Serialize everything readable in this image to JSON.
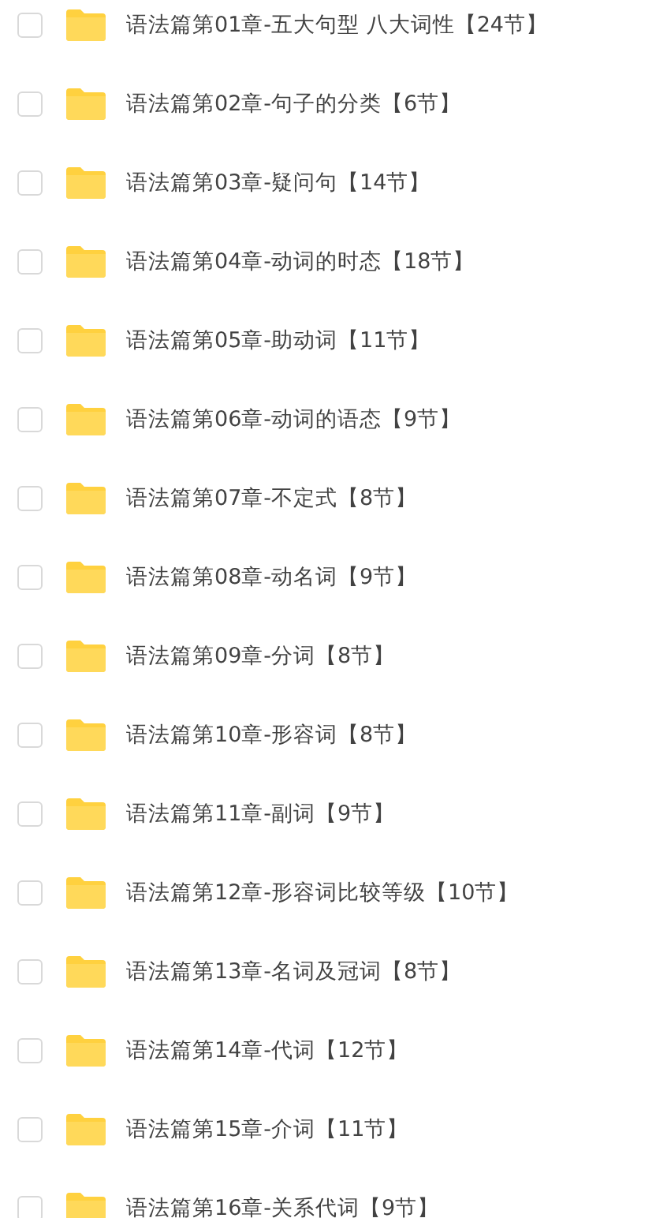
{
  "folders": [
    {
      "name": "语法篇第01章-五大句型 八大词性【24节】",
      "checked": false
    },
    {
      "name": "语法篇第02章-句子的分类【6节】",
      "checked": false
    },
    {
      "name": "语法篇第03章-疑问句【14节】",
      "checked": false
    },
    {
      "name": "语法篇第04章-动词的时态【18节】",
      "checked": false
    },
    {
      "name": "语法篇第05章-助动词【11节】",
      "checked": false
    },
    {
      "name": "语法篇第06章-动词的语态【9节】",
      "checked": false
    },
    {
      "name": "语法篇第07章-不定式【8节】",
      "checked": false
    },
    {
      "name": "语法篇第08章-动名词【9节】",
      "checked": false
    },
    {
      "name": "语法篇第09章-分词【8节】",
      "checked": false
    },
    {
      "name": "语法篇第10章-形容词【8节】",
      "checked": false
    },
    {
      "name": "语法篇第11章-副词【9节】",
      "checked": false
    },
    {
      "name": "语法篇第12章-形容词比较等级【10节】",
      "checked": false
    },
    {
      "name": "语法篇第13章-名词及冠词【8节】",
      "checked": false
    },
    {
      "name": "语法篇第14章-代词【12节】",
      "checked": false
    },
    {
      "name": "语法篇第15章-介词【11节】",
      "checked": false
    },
    {
      "name": "语法篇第16章-关系代词【9节】",
      "checked": false
    }
  ]
}
